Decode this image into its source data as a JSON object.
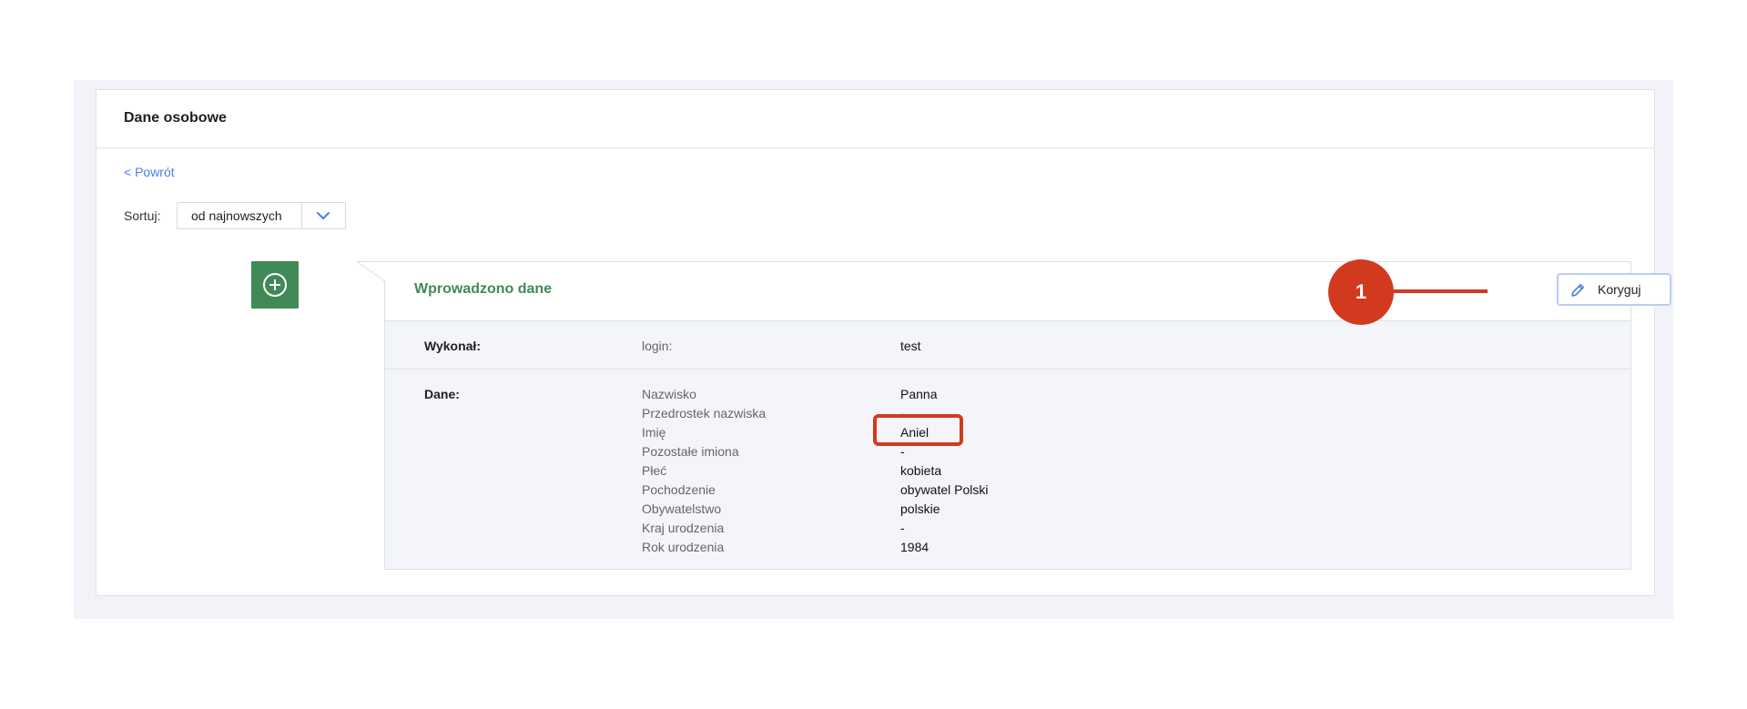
{
  "page": {
    "title": "Dane osobowe",
    "back_link": "< Powrót"
  },
  "sort": {
    "label": "Sortuj:",
    "selected": "od najnowszych"
  },
  "entry": {
    "title": "Wprowadzono dane",
    "edit_button": "Koryguj",
    "performed_by": {
      "label": "Wykonał:",
      "key": "login:",
      "value": "test"
    },
    "data": {
      "label": "Dane:",
      "fields": [
        {
          "key": "Nazwisko",
          "value": "Panna"
        },
        {
          "key": "Przedrostek nazwiska",
          "value": "-"
        },
        {
          "key": "Imię",
          "value": "Aniel"
        },
        {
          "key": "Pozostałe imiona",
          "value": "-"
        },
        {
          "key": "Płeć",
          "value": "kobieta"
        },
        {
          "key": "Pochodzenie",
          "value": "obywatel Polski"
        },
        {
          "key": "Obywatelstwo",
          "value": "polskie"
        },
        {
          "key": "Kraj urodzenia",
          "value": "-"
        },
        {
          "key": "Rok urodzenia",
          "value": "1984"
        }
      ]
    }
  },
  "annotation": {
    "number": "1",
    "color": "#d23a1f"
  },
  "colors": {
    "accent_green": "#3f8a57",
    "link_blue": "#4a7de8"
  }
}
